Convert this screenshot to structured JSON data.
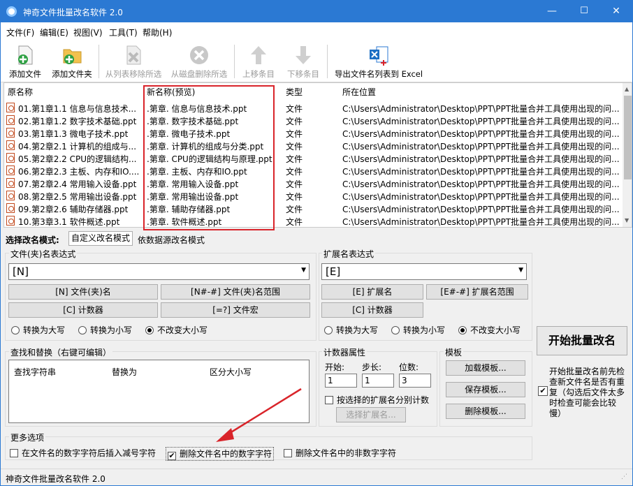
{
  "window": {
    "title": "神奇文件批量改名软件 2.0",
    "minimize": "—",
    "maximize": "☐",
    "close": "✕"
  },
  "menu": [
    "文件(F)",
    "编辑(E)",
    "视图(V)",
    "工具(T)",
    "帮助(H)"
  ],
  "toolbar": {
    "add_file": "添加文件",
    "add_folder": "添加文件夹",
    "remove_from_list": "从列表移除所选",
    "delete_from_disk": "从磁盘删除所选",
    "move_up": "上移条目",
    "move_down": "下移条目",
    "export_excel": "导出文件名列表到 Excel"
  },
  "list": {
    "headers": {
      "original": "原名称",
      "new": "新名称(预览)",
      "type": "类型",
      "location": "所在位置"
    },
    "rows": [
      {
        "original": "01.第1章1.1 信息与信息技术...",
        "new": ".第章. 信息与信息技术.ppt",
        "type": "文件",
        "location": "C:\\Users\\Administrator\\Desktop\\PPT\\PPT批量合并工具使用出现的问..."
      },
      {
        "original": "02.第1章1.2 数字技术基础.ppt",
        "new": ".第章. 数字技术基础.ppt",
        "type": "文件",
        "location": "C:\\Users\\Administrator\\Desktop\\PPT\\PPT批量合并工具使用出现的问..."
      },
      {
        "original": "03.第1章1.3 微电子技术.ppt",
        "new": ".第章. 微电子技术.ppt",
        "type": "文件",
        "location": "C:\\Users\\Administrator\\Desktop\\PPT\\PPT批量合并工具使用出现的问..."
      },
      {
        "original": "04.第2章2.1 计算机的组成与...",
        "new": ".第章. 计算机的组成与分类.ppt",
        "type": "文件",
        "location": "C:\\Users\\Administrator\\Desktop\\PPT\\PPT批量合并工具使用出现的问..."
      },
      {
        "original": "05.第2章2.2 CPU的逻辑结构...",
        "new": ".第章. CPU的逻辑结构与原理.ppt",
        "type": "文件",
        "location": "C:\\Users\\Administrator\\Desktop\\PPT\\PPT批量合并工具使用出现的问..."
      },
      {
        "original": "06.第2章2.3 主板、内存和IO....",
        "new": ".第章. 主板、内存和IO.ppt",
        "type": "文件",
        "location": "C:\\Users\\Administrator\\Desktop\\PPT\\PPT批量合并工具使用出现的问..."
      },
      {
        "original": "07.第2章2.4 常用输入设备.ppt",
        "new": ".第章. 常用输入设备.ppt",
        "type": "文件",
        "location": "C:\\Users\\Administrator\\Desktop\\PPT\\PPT批量合并工具使用出现的问..."
      },
      {
        "original": "08.第2章2.5 常用输出设备.ppt",
        "new": ".第章. 常用输出设备.ppt",
        "type": "文件",
        "location": "C:\\Users\\Administrator\\Desktop\\PPT\\PPT批量合并工具使用出现的问..."
      },
      {
        "original": "09.第2章2.6 辅助存储器.ppt",
        "new": ".第章. 辅助存储器.ppt",
        "type": "文件",
        "location": "C:\\Users\\Administrator\\Desktop\\PPT\\PPT批量合并工具使用出现的问..."
      },
      {
        "original": "10.第3章3.1 软件概述.ppt",
        "new": ".第章. 软件概述.ppt",
        "type": "文件",
        "location": "C:\\Users\\Administrator\\Desktop\\PPT\\PPT批量合并工具使用出现的问..."
      }
    ]
  },
  "mode": {
    "label": "选择改名模式:",
    "tab_custom": "自定义改名模式",
    "tab_datasource": "依数据源改名模式"
  },
  "filename_expr": {
    "title": "文件(夹)名表达式",
    "value": "[N]",
    "btn_n": "[N] 文件(夹)名",
    "btn_range": "[N#-#] 文件(夹)名范围",
    "btn_counter": "[C] 计数器",
    "btn_macro": "[=?] 文件宏",
    "upper": "转换为大写",
    "lower": "转换为小写",
    "nochange": "不改变大小写"
  },
  "ext_expr": {
    "title": "扩展名表达式",
    "value": "[E]",
    "btn_e": "[E] 扩展名",
    "btn_range": "[E#-#] 扩展名范围",
    "btn_counter": "[C] 计数器",
    "upper": "转换为大写",
    "lower": "转换为小写",
    "nochange": "不改变大小写"
  },
  "start_button": "开始批量改名",
  "check_dup": "开始批量改名前先检查新文件名是否有重复（勾选后文件太多时检查可能会比较慢）",
  "replace": {
    "title": "查找和替换（右键可编辑）",
    "col_find": "查找字符串",
    "col_replace": "替换为",
    "col_case": "区分大小写"
  },
  "counter": {
    "title": "计数器属性",
    "start_label": "开始:",
    "step_label": "步长:",
    "digits_label": "位数:",
    "start": "1",
    "step": "1",
    "digits": "3",
    "by_ext": "按选择的扩展名分别计数",
    "select_ext": "选择扩展名..."
  },
  "template": {
    "title": "模板",
    "load": "加载模板...",
    "save": "保存模板...",
    "delete": "删除模板..."
  },
  "more": {
    "title": "更多选项",
    "opt_minus": "在文件名的数字字符后插入减号字符",
    "opt_del_digits": "删除文件名中的数字字符",
    "opt_del_nondigits": "删除文件名中的非数字字符"
  },
  "status": "神奇文件批量改名软件 2.0",
  "colors": {
    "titlebar": "#2b79d3",
    "highlight": "#d9242a"
  }
}
